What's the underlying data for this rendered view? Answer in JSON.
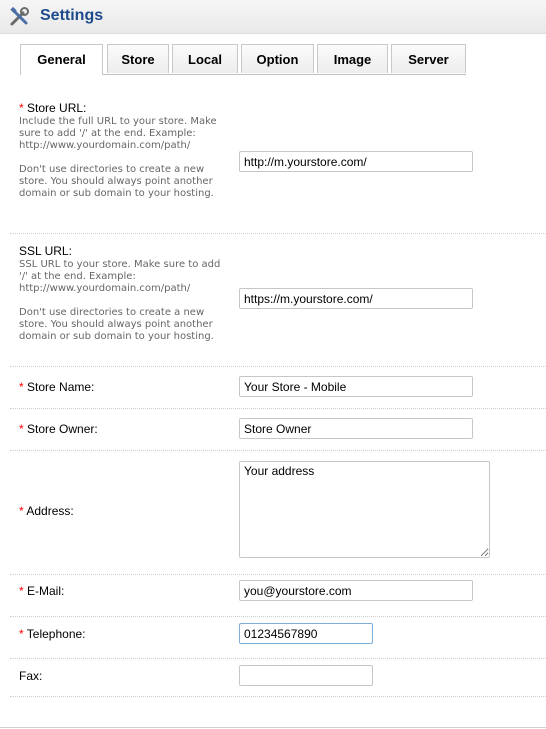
{
  "header": {
    "title": "Settings",
    "icon": "tools-icon"
  },
  "tabs": [
    {
      "label": "General",
      "active": true
    },
    {
      "label": "Store",
      "active": false
    },
    {
      "label": "Local",
      "active": false
    },
    {
      "label": "Option",
      "active": false
    },
    {
      "label": "Image",
      "active": false
    },
    {
      "label": "Server",
      "active": false
    }
  ],
  "form": {
    "store_url": {
      "required": "*",
      "label": "Store URL:",
      "help1": "Include the full URL to your store. Make sure to add '/' at the end. Example: http://www.yourdomain.com/path/",
      "help2": "Don't use directories to create a new store. You should always point another domain or sub domain to your hosting.",
      "value": "http://m.yourstore.com/"
    },
    "ssl_url": {
      "label": "SSL URL:",
      "help1": "SSL URL to your store. Make sure to add '/' at the end. Example: http://www.yourdomain.com/path/",
      "help2": "Don't use directories to create a new store. You should always point another domain or sub domain to your hosting.",
      "value": "https://m.yourstore.com/"
    },
    "store_name": {
      "required": "*",
      "label": "Store Name:",
      "value": "Your Store - Mobile"
    },
    "store_owner": {
      "required": "*",
      "label": "Store Owner:",
      "value": "Store Owner"
    },
    "address": {
      "required": "*",
      "label": "Address:",
      "value": "Your address"
    },
    "email": {
      "required": "*",
      "label": "E-Mail:",
      "value": "you@yourstore.com"
    },
    "telephone": {
      "required": "*",
      "label": "Telephone:",
      "value": "01234567890"
    },
    "fax": {
      "label": "Fax:",
      "value": ""
    }
  },
  "colors": {
    "title": "#1e4b8c",
    "required": "#ff0000",
    "help_text": "#666666"
  }
}
